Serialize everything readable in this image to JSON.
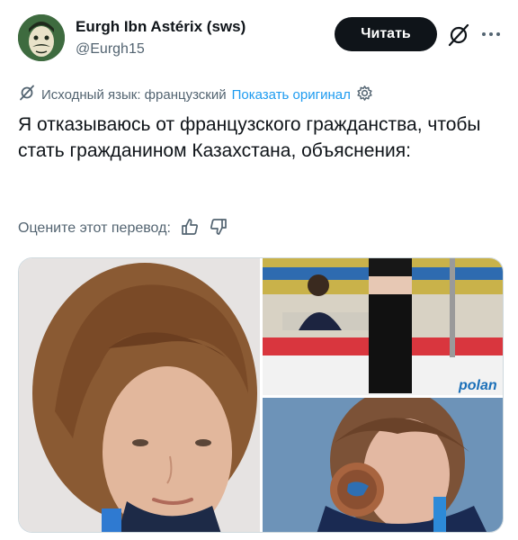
{
  "author": {
    "name": "Eurgh Ibn Astérix (sws)",
    "handle": "@Eurgh15"
  },
  "header": {
    "follow_label": "Читать",
    "grok_icon": "grok-slash-icon",
    "more_icon": "more-dots-icon"
  },
  "translation": {
    "source_label": "Исходный язык: французский",
    "show_original_label": "Показать оригинал",
    "rate_label": "Оцените этот перевод:"
  },
  "tweet": {
    "text": "Я отказываюсь от французского гражданства, чтобы стать гражданином Казахстана, объяснения:"
  },
  "media": {
    "photo_2_banner": "polan"
  },
  "colors": {
    "accent": "#1d9bf0",
    "text": "#0f1419",
    "secondary": "#536471",
    "button_bg": "#0f1419"
  }
}
